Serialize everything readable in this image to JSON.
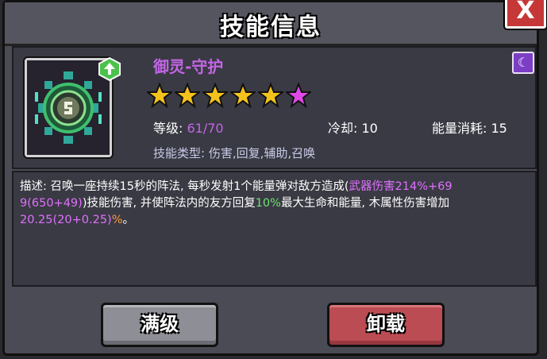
{
  "dialog": {
    "title": "技能信息",
    "close_label": "X"
  },
  "skill": {
    "name": "御灵-守护",
    "stars_filled": 5,
    "stars_bonus": 1,
    "level_label": "等级:",
    "level_value": "61/70",
    "cooldown_label": "冷却:",
    "cooldown_value": "10",
    "energy_label": "能量消耗:",
    "energy_value": "15",
    "types_label": "技能类型: 伤害,回复,辅助,召唤",
    "rarity_icon": "moon-icon"
  },
  "description": {
    "line1_a": "描述: 召唤一座持续15秒的阵法, 每秒发射1个能量弹对敌方造成(",
    "line1_b": "武器伤害214%+69",
    "line2_a": "9(650+49)",
    "line2_b": ")技能伤害, 并使阵法内的友方回复",
    "line2_c": "10%",
    "line2_d": "最大生命和能量, 木属性伤害增加",
    "line3_a": "20.25(20+0.25)",
    "line3_b": "%",
    "line3_c": "。"
  },
  "buttons": {
    "max_level": "满级",
    "unequip": "卸载"
  },
  "colors": {
    "name": "#c465e8",
    "star_gold": "#f4c21c",
    "star_bonus": "#e048e8",
    "close_red": "#c63838",
    "unequip_red": "#bc4c54"
  }
}
